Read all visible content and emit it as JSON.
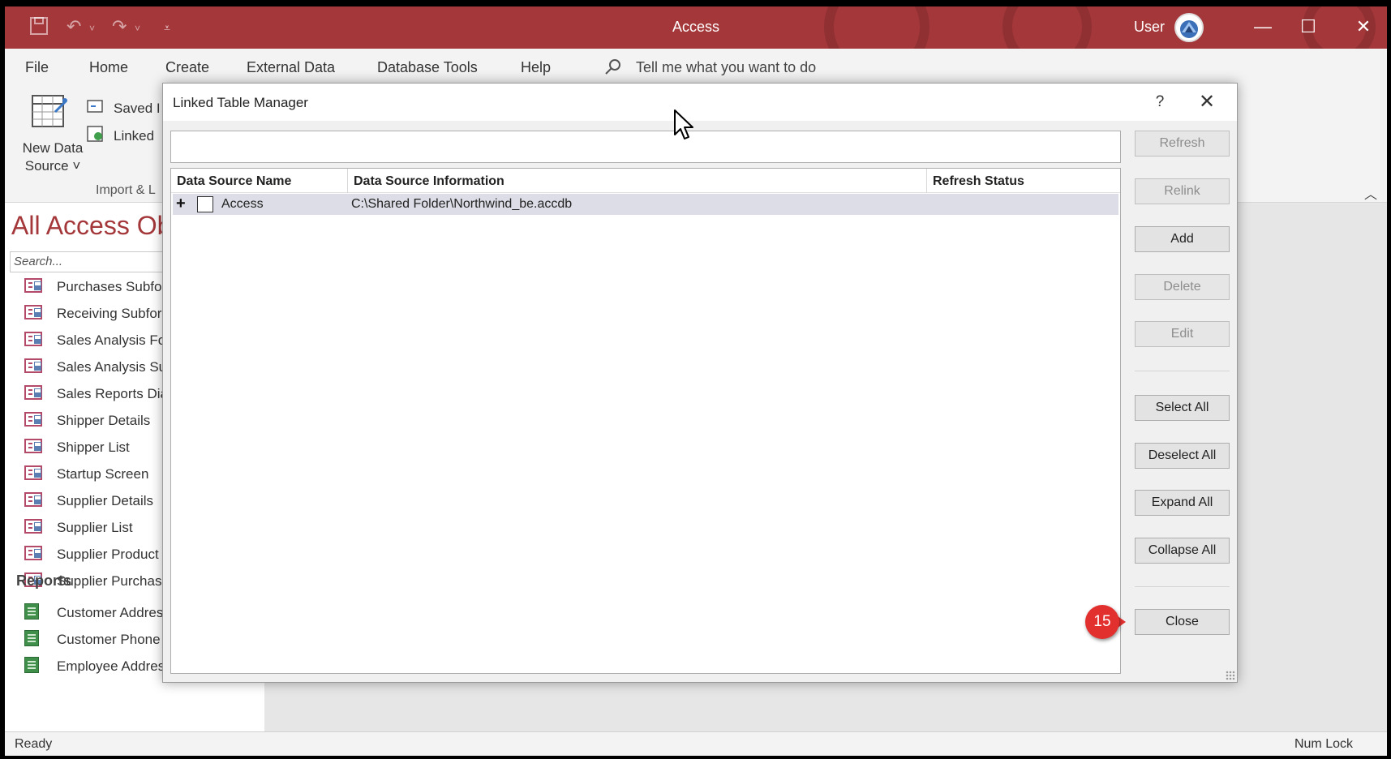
{
  "app": {
    "title": "Access",
    "user": "User",
    "window_controls": {
      "minimize": "—",
      "maximize": "☐",
      "close": "✕"
    }
  },
  "menu": {
    "items": [
      "File",
      "Home",
      "Create",
      "External Data",
      "Database Tools",
      "Help"
    ],
    "tell_me": "Tell me what you want to do"
  },
  "ribbon": {
    "new_data_source": "New Data Source ˅",
    "saved_imports": "Saved I",
    "linked_table_manager": "Linked",
    "group_label": "Import & L"
  },
  "nav": {
    "title": "All Access Ob",
    "search_placeholder": "Search...",
    "form_items": [
      "Purchases Subfo",
      "Receiving Subfor",
      "Sales Analysis Fo",
      "Sales Analysis Su",
      "Sales Reports Dia",
      "Shipper Details",
      "Shipper List",
      "Startup Screen",
      "Supplier Details",
      "Supplier List",
      "Supplier Product",
      "Supplier Purchas"
    ],
    "reports_heading": "Reports",
    "report_items": [
      "Customer Addres",
      "Customer Phone Book",
      "Employee Address Book"
    ]
  },
  "status": {
    "ready": "Ready",
    "num_lock": "Num Lock"
  },
  "dialog": {
    "title": "Linked Table Manager",
    "help": "?",
    "close": "✕",
    "columns": [
      "Data Source Name",
      "Data Source Information",
      "Refresh Status"
    ],
    "row": {
      "expand": "+",
      "name": "Access",
      "info": "C:\\Shared Folder\\Northwind_be.accdb",
      "status": ""
    },
    "buttons": {
      "refresh": "Refresh",
      "relink": "Relink",
      "add": "Add",
      "delete": "Delete",
      "edit": "Edit",
      "select_all": "Select All",
      "deselect_all": "Deselect All",
      "expand_all": "Expand All",
      "collapse_all": "Collapse All",
      "close": "Close"
    }
  },
  "step_badge": "15",
  "colors": {
    "accent": "#a4373a",
    "badge": "#e2302f"
  }
}
